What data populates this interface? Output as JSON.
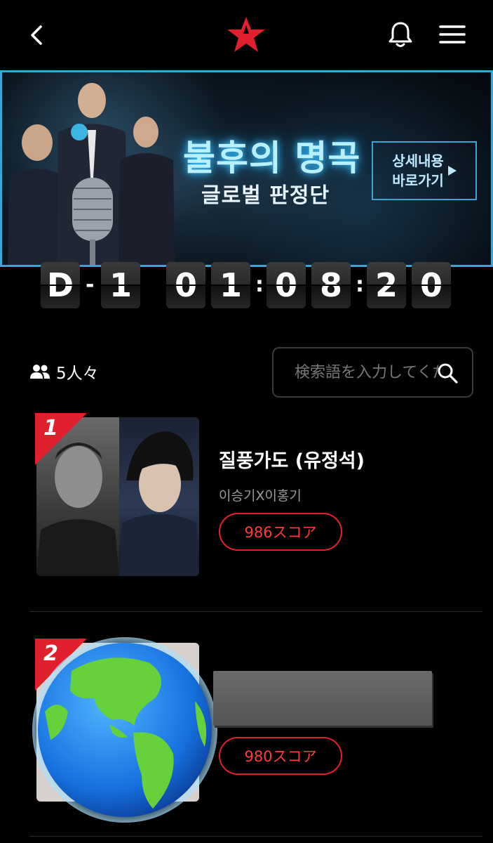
{
  "header": {
    "back_icon": "chevron-left-icon",
    "logo_icon": "star-logo-icon",
    "bell_icon": "bell-icon",
    "menu_icon": "hamburger-menu-icon"
  },
  "banner": {
    "title": "불후의 명곡",
    "subtitle": "글로벌 판정단",
    "cta": "상세내용\n바로가기"
  },
  "countdown": {
    "days": [
      "D",
      "1"
    ],
    "hours": [
      "0",
      "1"
    ],
    "minutes": [
      "0",
      "8"
    ],
    "seconds": [
      "2",
      "0"
    ]
  },
  "meta": {
    "people_count": "5人々",
    "search_placeholder": "検索語を入力してください"
  },
  "list": [
    {
      "rank": "1",
      "title": "질풍가도 (유정석)",
      "artist": "이승기X이홍기",
      "score": "986スコア"
    },
    {
      "rank": "2",
      "title": "",
      "artist": "",
      "score": "980スコア"
    }
  ],
  "colors": {
    "accent_red": "#e0202c",
    "banner_border": "#39a6d6"
  }
}
